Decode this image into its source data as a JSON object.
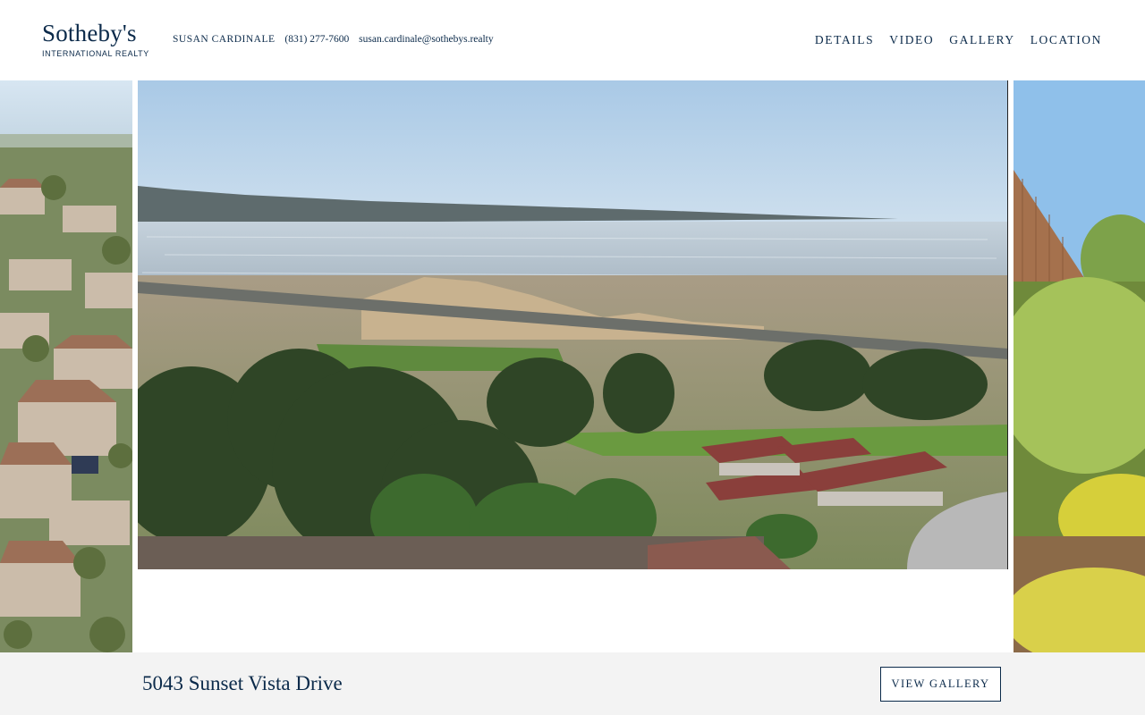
{
  "brand": {
    "name": "Sotheby's",
    "subtitle": "INTERNATIONAL REALTY"
  },
  "agent": {
    "name": "SUSAN CARDINALE",
    "phone": "(831) 277-7600",
    "email": "susan.cardinale@sothebys.realty"
  },
  "nav": [
    "DETAILS",
    "VIDEO",
    "GALLERY",
    "LOCATION"
  ],
  "listing": {
    "address": "5043 Sunset Vista Drive",
    "gallery_button": "VIEW GALLERY"
  },
  "colors": {
    "brand_navy": "#0b2a4a",
    "footer_bg": "#f3f3f3"
  }
}
